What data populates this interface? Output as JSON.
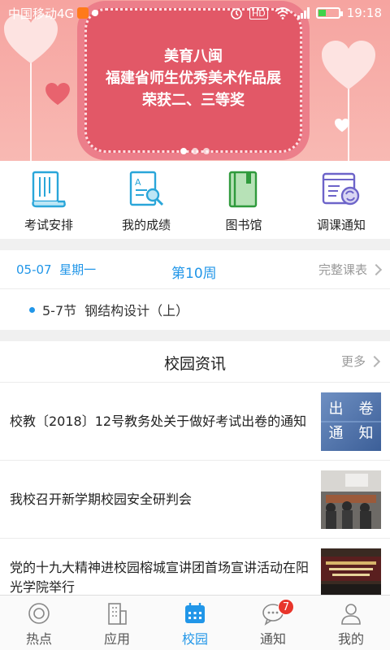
{
  "status_bar": {
    "carrier": "中国移动4G",
    "time": "19:18",
    "battery_level": 0.35,
    "icons": [
      "app-notification-icon",
      "dot-icon",
      "alarm-icon",
      "hd-icon",
      "wifi-icon",
      "signal-icon",
      "battery-icon"
    ]
  },
  "banner": {
    "line1": "美育八闽",
    "line2": "福建省师生优秀美术作品展",
    "line3": "荣获二、三等奖",
    "colors": {
      "background": "#f6a4a0",
      "plaque": "#e25867"
    }
  },
  "quick_access": [
    {
      "label": "考试安排",
      "icon": "exam-scroll-icon"
    },
    {
      "label": "我的成绩",
      "icon": "grade-search-icon"
    },
    {
      "label": "图书馆",
      "icon": "book-icon"
    },
    {
      "label": "调课通知",
      "icon": "schedule-change-icon"
    }
  ],
  "schedule": {
    "date": "05-07",
    "weekday": "星期一",
    "week": "第10周",
    "more_label": "完整课表",
    "course": {
      "period": "5-7节",
      "name": "钢结构设计（上）"
    }
  },
  "news": {
    "title": "校园资讯",
    "more_label": "更多",
    "items": [
      {
        "title": "校教〔2018〕12号教务处关于做好考试出卷的通知",
        "thumb_text": [
          "出",
          "卷",
          "通",
          "知"
        ]
      },
      {
        "title": "我校召开新学期校园安全研判会"
      },
      {
        "title": "党的十九大精神进校园榕城宣讲团首场宣讲活动在阳光学院举行"
      }
    ]
  },
  "bottom_nav": {
    "items": [
      {
        "label": "热点",
        "icon": "hot-topics-icon"
      },
      {
        "label": "应用",
        "icon": "apps-building-icon"
      },
      {
        "label": "校园",
        "icon": "campus-calendar-icon",
        "active": true
      },
      {
        "label": "通知",
        "icon": "chat-bubble-icon",
        "badge": "7"
      },
      {
        "label": "我的",
        "icon": "profile-icon"
      }
    ],
    "accent": "#2196e8"
  }
}
